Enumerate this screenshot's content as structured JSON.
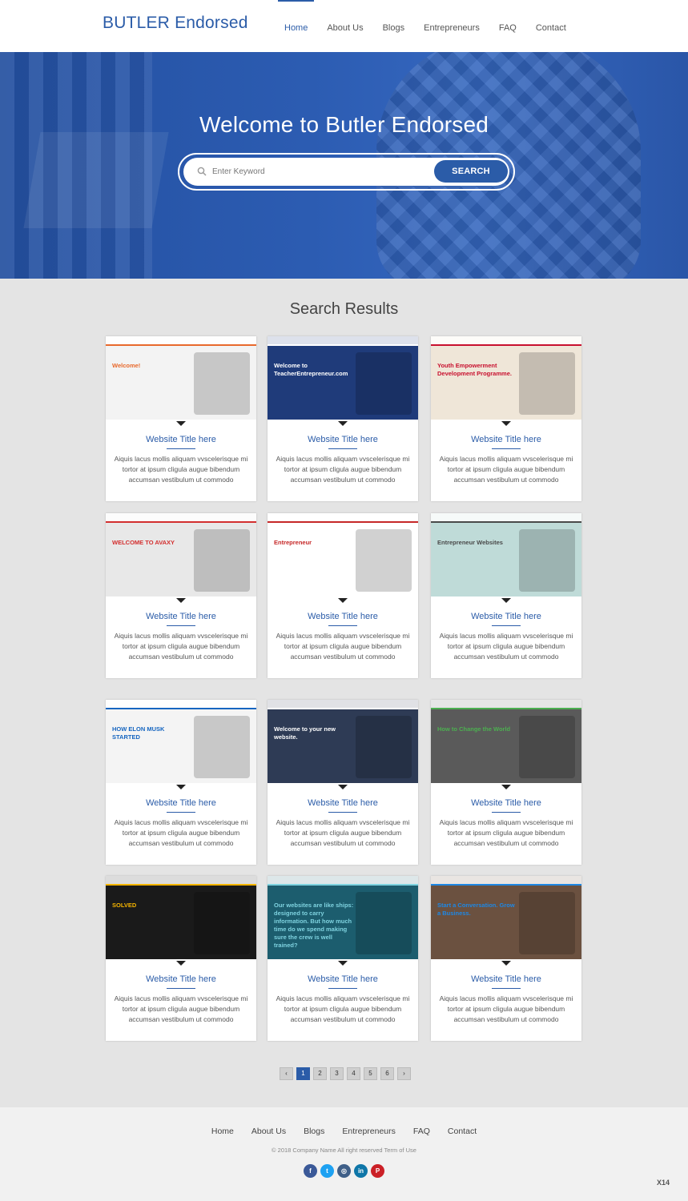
{
  "brand": {
    "name": "BUTLER Endorsed"
  },
  "nav": {
    "items": [
      "Home",
      "About Us",
      "Blogs",
      "Entrepreneurs",
      "FAQ",
      "Contact"
    ],
    "active": "Home"
  },
  "hero": {
    "title": "Welcome to Butler Endorsed",
    "search_placeholder": "Enter Keyword",
    "search_button": "SEARCH"
  },
  "results": {
    "title": "Search Results",
    "cards": [
      {
        "title": "Website Title here",
        "desc": "Aiquis lacus mollis aliquam vvscelerisque mi tortor at ipsum cligula augue bibendum accumsan vestibulum ut commodo",
        "thumb": {
          "name": "entrepreneurs-blog",
          "caption": "Welcome!",
          "bg": "#f3f3f3",
          "accent": "#e8692c"
        }
      },
      {
        "title": "Website Title here",
        "desc": "Aiquis lacus mollis aliquam vvscelerisque mi tortor at ipsum cligula augue bibendum accumsan vestibulum ut commodo",
        "thumb": {
          "name": "teacher-entrepreneur",
          "caption": "Welcome to TeacherEntrepreneur.com",
          "bg": "#1f3b7a",
          "accent": "#ffffff"
        }
      },
      {
        "title": "Website Title here",
        "desc": "Aiquis lacus mollis aliquam vvscelerisque mi tortor at ipsum cligula augue bibendum accumsan vestibulum ut commodo",
        "thumb": {
          "name": "youth-empowerment",
          "caption": "Youth Empowerment Development Programme.",
          "bg": "#efe6d8",
          "accent": "#c8102e"
        }
      },
      {
        "title": "Website Title here",
        "desc": "Aiquis lacus mollis aliquam vvscelerisque mi tortor at ipsum cligula augue bibendum accumsan vestibulum ut commodo",
        "thumb": {
          "name": "avaxy",
          "caption": "WELCOME TO AVAXY",
          "bg": "#e8e8e8",
          "accent": "#d32f2f"
        }
      },
      {
        "title": "Website Title here",
        "desc": "Aiquis lacus mollis aliquam vvscelerisque mi tortor at ipsum cligula augue bibendum accumsan vestibulum ut commodo",
        "thumb": {
          "name": "entrepreneur-magazine",
          "caption": "Entrepreneur",
          "bg": "#ffffff",
          "accent": "#c62828"
        }
      },
      {
        "title": "Website Title here",
        "desc": "Aiquis lacus mollis aliquam vvscelerisque mi tortor at ipsum cligula augue bibendum accumsan vestibulum ut commodo",
        "thumb": {
          "name": "main-street-studio",
          "caption": "Entrepreneur Websites",
          "bg": "#bfdbd8",
          "accent": "#4a4a4a"
        }
      },
      {
        "title": "Website Title here",
        "desc": "Aiquis lacus mollis aliquam vvscelerisque mi tortor at ipsum cligula augue bibendum accumsan vestibulum ut commodo",
        "thumb": {
          "name": "elon-musk-infographic",
          "caption": "HOW ELON MUSK STARTED",
          "bg": "#f4f4f4",
          "accent": "#1565c0"
        }
      },
      {
        "title": "Website Title here",
        "desc": "Aiquis lacus mollis aliquam vvscelerisque mi tortor at ipsum cligula augue bibendum accumsan vestibulum ut commodo",
        "thumb": {
          "name": "welcome-new-website",
          "caption": "Welcome to your new website.",
          "bg": "#2e3b55",
          "accent": "#ffffff"
        }
      },
      {
        "title": "Website Title here",
        "desc": "Aiquis lacus mollis aliquam vvscelerisque mi tortor at ipsum cligula augue bibendum accumsan vestibulum ut commodo",
        "thumb": {
          "name": "change-the-world",
          "caption": "How to Change the World",
          "bg": "#5a5a5a",
          "accent": "#4caf50"
        }
      },
      {
        "title": "Website Title here",
        "desc": "Aiquis lacus mollis aliquam vvscelerisque mi tortor at ipsum cligula augue bibendum accumsan vestibulum ut commodo",
        "thumb": {
          "name": "solved-blog",
          "caption": "SOLVED",
          "bg": "#1a1a1a",
          "accent": "#f5b400"
        }
      },
      {
        "title": "Website Title here",
        "desc": "Aiquis lacus mollis aliquam vvscelerisque mi tortor at ipsum cligula augue bibendum accumsan vestibulum ut commodo",
        "thumb": {
          "name": "conference-ships",
          "caption": "Our websites are like ships: designed to carry information. But how much time do we spend making sure the crew is well trained?",
          "bg": "#1c5d6e",
          "accent": "#7fd3e0"
        }
      },
      {
        "title": "Website Title here",
        "desc": "Aiquis lacus mollis aliquam vvscelerisque mi tortor at ipsum cligula augue bibendum accumsan vestibulum ut commodo",
        "thumb": {
          "name": "micromentor",
          "caption": "Start a Conversation. Grow a Business.",
          "bg": "#6b5140",
          "accent": "#1e88e5"
        }
      }
    ]
  },
  "pagination": {
    "prev": "‹",
    "pages": [
      "1",
      "2",
      "3",
      "4",
      "5",
      "6"
    ],
    "current": "1",
    "next": "›"
  },
  "footer": {
    "nav": [
      "Home",
      "About Us",
      "Blogs",
      "Entrepreneurs",
      "FAQ",
      "Contact"
    ],
    "copyright": "© 2018 Company Name  All right reserved  Term of Use",
    "social": [
      {
        "name": "facebook",
        "glyph": "f",
        "color": "#3b5998"
      },
      {
        "name": "twitter",
        "glyph": "t",
        "color": "#1da1f2"
      },
      {
        "name": "instagram",
        "glyph": "◎",
        "color": "#3f5f88"
      },
      {
        "name": "linkedin",
        "glyph": "in",
        "color": "#0e76a8"
      },
      {
        "name": "pinterest",
        "glyph": "P",
        "color": "#cb2027"
      }
    ]
  },
  "badge": "X14"
}
